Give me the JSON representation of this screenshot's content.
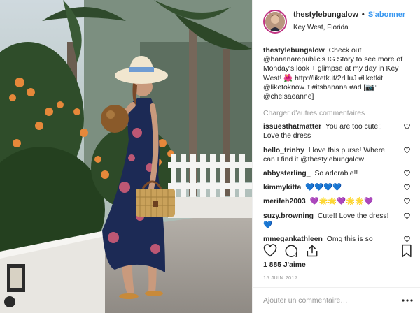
{
  "header": {
    "username": "thestylebungalow",
    "dot": "•",
    "follow_label": "S'abonner",
    "location": "Key West, Florida"
  },
  "caption": {
    "username": "thestylebungalow",
    "text": "Check out @bananarepublic's IG Story to see more of Monday's look + glimpse at my day in Key West! 🌺 http://liketk.it/2rHuJ #liketkit @liketoknow.it #itsbanana #ad [📷: @chelsaeanne]"
  },
  "load_more_label": "Charger d'autres commentaires",
  "comments": [
    {
      "username": "issuesthatmatter",
      "text": "You are too cute!! Love the dress"
    },
    {
      "username": "hello_trinhy",
      "text": "I love this purse! Where can I find it @thestylebungalow"
    },
    {
      "username": "abbysterling_",
      "text": "So adorable!!"
    },
    {
      "username": "kimmykitta",
      "text": "💙💙💙💙"
    },
    {
      "username": "merifeh2003",
      "text": "💜🌟🌟💜🌟🌟💜"
    },
    {
      "username": "suzy.browning",
      "text": "Cute!! Love the dress! 💙"
    },
    {
      "username": "mmegankathleen",
      "text": "Omg this is so adorable"
    }
  ],
  "likes_label": "1 885 J'aime",
  "date_label": "15 JUIN 2017",
  "add_comment_placeholder": "Ajouter un commentaire…",
  "icons": {
    "like": "heart-icon",
    "comment": "comment-icon",
    "share": "share-icon",
    "save": "bookmark-icon",
    "more": "more-options-icon"
  },
  "colors": {
    "link_blue": "#3897f0",
    "text": "#262626",
    "muted": "#999999",
    "divider": "#efefef"
  }
}
